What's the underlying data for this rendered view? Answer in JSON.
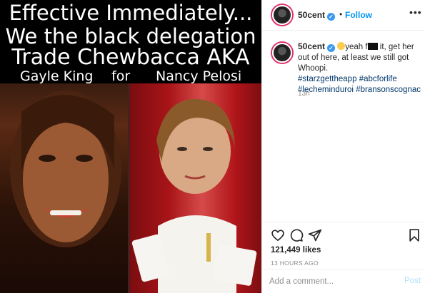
{
  "media": {
    "caption_line1": "Effective Immediately...",
    "caption_line2": "We the black delegation",
    "caption_line3": "Trade Chewbacca AKA",
    "caption_name_left": "Gayle King",
    "caption_for": "for",
    "caption_name_right": "Nancy Pelosi"
  },
  "header": {
    "username": "50cent",
    "separator": "•",
    "follow_label": "Follow",
    "more_label": "•••"
  },
  "caption": {
    "username": "50cent",
    "text_part1": "yeah f",
    "text_part2": " it, get her out of here, at least we still got Whoopi.",
    "tags": [
      "#starzgettheapp",
      "#abcforlife",
      "#lecheminduroi",
      "#bransonscognac"
    ],
    "time_ago": "13h"
  },
  "actions": {
    "icons": [
      "heart-icon",
      "comment-icon",
      "share-icon",
      "save-icon"
    ]
  },
  "likes": "121,449 likes",
  "post_date": "13 HOURS AGO",
  "add_comment": {
    "placeholder": "Add a comment...",
    "post_label": "Post"
  },
  "colors": {
    "link_blue": "#0095f6",
    "hashtag_blue": "#00376b",
    "muted_gray": "#8e8e8e",
    "post_disabled": "#b2dffc"
  }
}
